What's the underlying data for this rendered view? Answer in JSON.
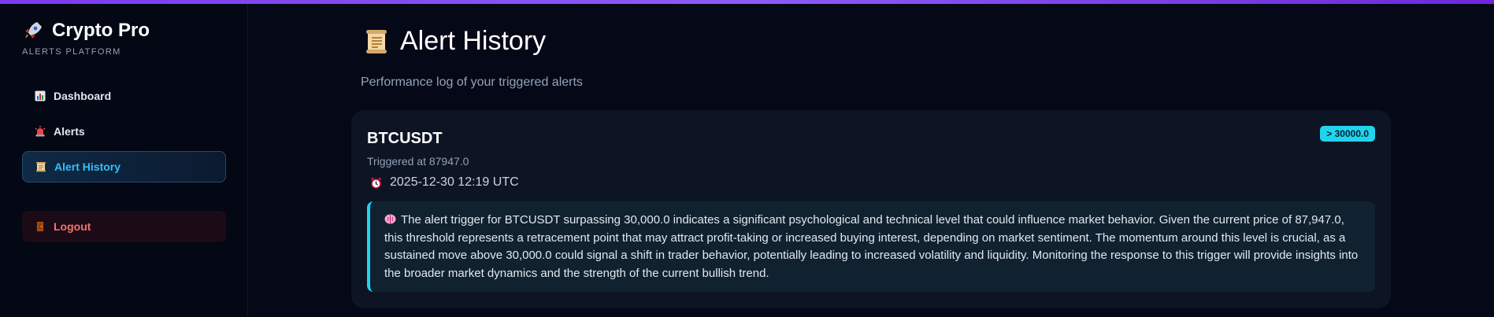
{
  "brand": {
    "title": "Crypto Pro",
    "subtitle": "ALERTS PLATFORM",
    "icon": "rocket-icon"
  },
  "sidebar": {
    "items": [
      {
        "label": "Dashboard",
        "icon": "bar-chart-icon",
        "active": false
      },
      {
        "label": "Alerts",
        "icon": "siren-icon",
        "active": false
      },
      {
        "label": "Alert History",
        "icon": "scroll-icon",
        "active": true
      }
    ],
    "logout": {
      "label": "Logout",
      "icon": "door-icon"
    }
  },
  "page": {
    "title": "Alert History",
    "title_icon": "scroll-icon",
    "subtitle": "Performance log of your triggered alerts"
  },
  "alerts": [
    {
      "symbol": "BTCUSDT",
      "condition_badge": "> 30000.0",
      "triggered_text": "Triggered at 87947.0",
      "timestamp": "2025-12-30 12:19 UTC",
      "insight": "The alert trigger for BTCUSDT surpassing 30,000.0 indicates a significant psychological and technical level that could influence market behavior. Given the current price of 87,947.0, this threshold represents a retracement point that may attract profit-taking or increased buying interest, depending on market sentiment. The momentum around this level is crucial, as a sustained move above 30,000.0 could signal a shift in trader behavior, potentially leading to increased volatility and liquidity. Monitoring the response to this trigger will provide insights into the broader market dynamics and the strength of the current bullish trend."
    }
  ],
  "colors": {
    "accent": "#22d3ee",
    "active_nav": "#38bdf8",
    "logout": "#f87171",
    "top_bar": "#8b5cf6"
  }
}
